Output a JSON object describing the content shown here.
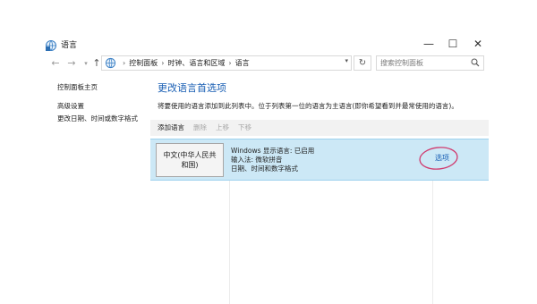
{
  "window": {
    "title": "语言",
    "controls": {
      "minimize": "—",
      "maximize": "☐",
      "close": "✕"
    }
  },
  "address": {
    "nav": {
      "back": "←",
      "forward": "→",
      "dropdown": "▾",
      "up": "↑"
    },
    "breadcrumbs": [
      "控制面板",
      "时钟、语言和区域",
      "语言"
    ],
    "separator": "›",
    "dropdown": "▾",
    "refresh": "↻",
    "search_placeholder": "搜索控制面板"
  },
  "sidebar": {
    "items": [
      {
        "label": "控制面板主页"
      },
      {
        "label": "高级设置"
      },
      {
        "label": "更改日期、时间或数字格式"
      }
    ]
  },
  "main": {
    "title": "更改语言首选项",
    "description": "将要使用的语言添加到此列表中。位于列表第一位的语言为主语言(即你希望看到并最常使用的语言)。",
    "toolbar": {
      "add": "添加语言",
      "remove": "删除",
      "move_up": "上移",
      "move_down": "下移"
    },
    "languages": [
      {
        "name": "中文(中华人民共和国)",
        "display_status": "Windows 显示语言: 已启用",
        "input": "输入法: 微软拼音",
        "format": "日期、时间和数字格式",
        "options_label": "选项"
      }
    ]
  },
  "colors": {
    "accent": "#1a5fb4",
    "selected_row": "#cce8f6",
    "annotation_circle": "#d03a6e"
  }
}
